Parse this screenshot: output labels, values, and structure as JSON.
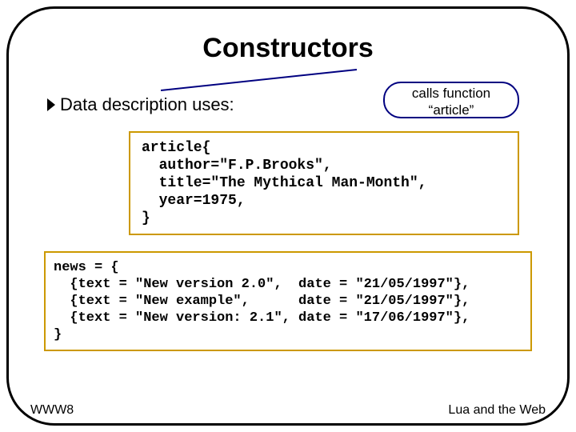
{
  "title": "Constructors",
  "bullet": "Data description uses:",
  "callout": {
    "line1": "calls function",
    "line2": "“article”"
  },
  "code1": "article{\n  author=\"F.P.Brooks\",\n  title=\"The Mythical Man-Month\",\n  year=1975,\n}",
  "code2": "news = {\n  {text = \"New version 2.0\",  date = \"21/05/1997\"},\n  {text = \"New example\",      date = \"21/05/1997\"},\n  {text = \"New version: 2.1\", date = \"17/06/1997\"},\n}",
  "footer": {
    "left": "WWW8",
    "right": "Lua and the Web"
  }
}
